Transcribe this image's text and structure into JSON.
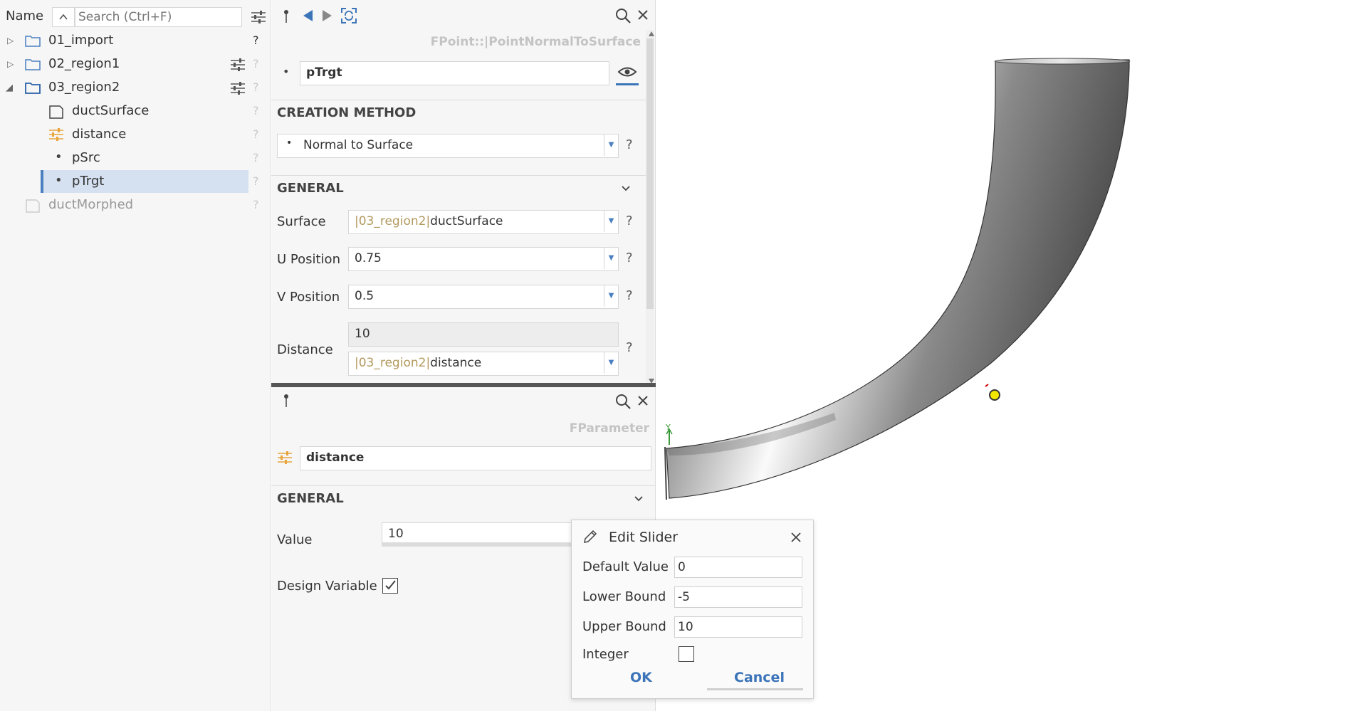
{
  "tree": {
    "header_name": "Name",
    "search_placeholder": "Search (Ctrl+F)",
    "items": [
      {
        "label": "01_import",
        "type": "folder"
      },
      {
        "label": "02_region1",
        "type": "folder"
      },
      {
        "label": "03_region2",
        "type": "folder"
      },
      {
        "label": "ductSurface",
        "type": "surface"
      },
      {
        "label": "distance",
        "type": "parameter"
      },
      {
        "label": "pSrc",
        "type": "point"
      },
      {
        "label": "pTrgt",
        "type": "point"
      },
      {
        "label": "ductMorphed",
        "type": "surface"
      }
    ],
    "help": "?"
  },
  "top_panel": {
    "class_label": "FPoint::|PointNormalToSurface",
    "name_value": "pTrgt",
    "creation_method_title": "CREATION METHOD",
    "creation_method_value": "Normal to Surface",
    "general_title": "GENERAL",
    "surface_label": "Surface",
    "surface_prefix": "|03_region2|",
    "surface_value": "ductSurface",
    "u_label": "U Position",
    "u_value": "0.75",
    "v_label": "V Position",
    "v_value": "0.5",
    "distance_label": "Distance",
    "distance_value": "10",
    "distance_prefix": "|03_region2|",
    "distance_ref": "distance"
  },
  "bottom_panel": {
    "class_label": "FParameter",
    "name_value": "distance",
    "general_title": "GENERAL",
    "value_label": "Value",
    "value": "10",
    "design_variable_label": "Design Variable",
    "design_variable_checked": true
  },
  "dialog": {
    "title": "Edit Slider",
    "default_label": "Default Value",
    "default_value": "0",
    "lower_label": "Lower Bound",
    "lower_value": "-5",
    "upper_label": "Upper Bound",
    "upper_value": "10",
    "integer_label": "Integer",
    "integer_checked": false,
    "ok_label": "OK",
    "cancel_label": "Cancel"
  },
  "viewport": {
    "axis_label": "Y"
  },
  "colors": {
    "accent": "#4a7fc1",
    "param_icon": "#e8a33a",
    "point_marker": "#f2e600"
  }
}
